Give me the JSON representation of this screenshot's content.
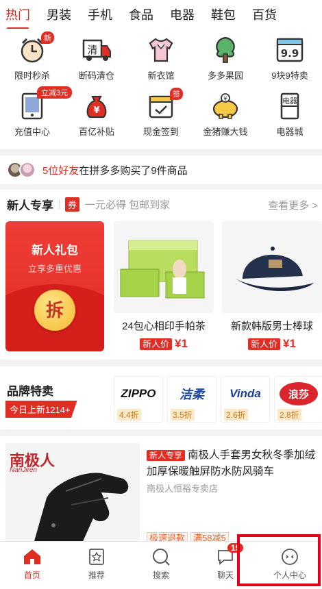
{
  "tabs": [
    "热门",
    "男装",
    "手机",
    "食品",
    "电器",
    "鞋包",
    "百货"
  ],
  "grid": {
    "row1": [
      {
        "label": "限时秒杀",
        "badge": "新"
      },
      {
        "label": "断码清仓",
        "icon_text": "清"
      },
      {
        "label": "新衣馆"
      },
      {
        "label": "多多果园"
      },
      {
        "label": "9块9特卖",
        "icon_text": "9.9"
      }
    ],
    "row2": [
      {
        "label": "充值中心",
        "badge": "立减3元"
      },
      {
        "label": "百亿补贴",
        "icon_text": "¥"
      },
      {
        "label": "现金签到",
        "badge": "签"
      },
      {
        "label": "金猪赚大钱",
        "icon_text": "¥"
      },
      {
        "label": "电器城",
        "icon_text": "电器"
      }
    ]
  },
  "friends": {
    "highlight": "5位好友",
    "text": "在拼多多购买了9件商品"
  },
  "newuser": {
    "title": "新人专享",
    "coupon": "券",
    "subtitle": "一元必得 包邮到家",
    "more": "查看更多 >",
    "gift": {
      "title": "新人礼包",
      "subtitle": "立享多重优惠",
      "button": "拆"
    },
    "products": [
      {
        "name": "24包心相印手帕茶",
        "tag": "新人价",
        "price": "¥1"
      },
      {
        "name": "新款韩版男士棒球",
        "tag": "新人价",
        "price": "¥1"
      }
    ]
  },
  "brand": {
    "title": "品牌特卖",
    "tag": "今日上新1214+",
    "logos": [
      {
        "name": "ZIPPO",
        "discount": "4.4折"
      },
      {
        "name": "洁柔",
        "discount": "3.5折"
      },
      {
        "name": "Vinda",
        "discount": "2.6折"
      },
      {
        "name": "浪莎",
        "discount": "2.8折"
      }
    ]
  },
  "bigproduct": {
    "brand_text": "南极人",
    "brand_sub": "NanJiren",
    "tag": "新人专享",
    "title": "南极人手套男女秋冬季加绒加厚保暖触屏防水防风骑车",
    "shop": "南极人恒裕专卖店",
    "tags": [
      "极速退款",
      "满58减5"
    ]
  },
  "bottomnav": [
    {
      "label": "首页"
    },
    {
      "label": "推荐"
    },
    {
      "label": "搜索"
    },
    {
      "label": "聊天",
      "badge": "15"
    },
    {
      "label": "个人中心"
    }
  ],
  "colors": {
    "accent": "#e02e24",
    "highlight": "#e4001b"
  }
}
